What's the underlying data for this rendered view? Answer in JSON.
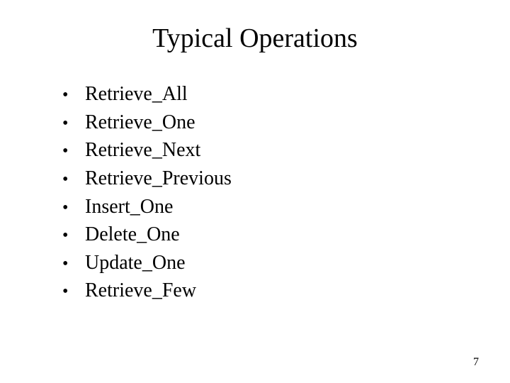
{
  "title": "Typical Operations",
  "bullets": [
    "Retrieve_All",
    "Retrieve_One",
    "Retrieve_Next",
    "Retrieve_Previous",
    "Insert_One",
    "Delete_One",
    "Update_One",
    "Retrieve_Few"
  ],
  "page_number": "7"
}
